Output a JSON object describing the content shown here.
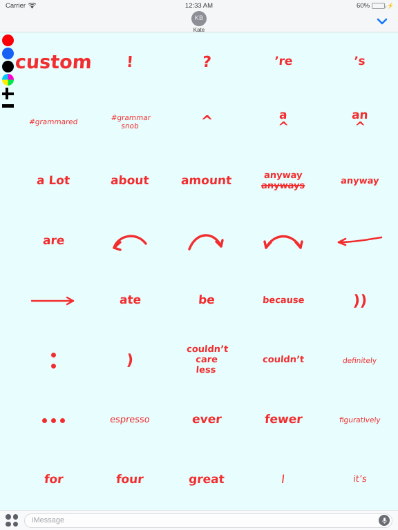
{
  "status_bar": {
    "carrier": "Carrier",
    "wifi_icon": "wifi-icon",
    "time": "12:33 AM",
    "battery_percent": "60%",
    "battery_level": 60,
    "battery_color": "#4cd964",
    "charging_icon": "lightning-bolt-icon"
  },
  "conversation_header": {
    "avatar_initials": "KB",
    "contact_name": "Kate",
    "expand_icon": "chevron-down-icon",
    "accent_color": "#1577ff"
  },
  "tool_rail": {
    "swatches": [
      {
        "name": "color-swatch-red",
        "label": "Red",
        "color": "#fb0007"
      },
      {
        "name": "color-swatch-blue",
        "label": "Blue",
        "color": "#1660f4"
      },
      {
        "name": "color-swatch-black",
        "label": "Black",
        "color": "#000000"
      },
      {
        "name": "color-wheel",
        "label": "Color wheel",
        "color": "multicolor"
      }
    ],
    "zoom_in_icon": "plus-icon",
    "zoom_out_icon": "minus-icon"
  },
  "canvas": {
    "background_color": "#e8fdfd",
    "ink_color": "#f22d2f",
    "rows": 8,
    "columns": 5
  },
  "stickers": [
    {
      "id": "custom",
      "text": "custom",
      "kind": "text",
      "size": "xl"
    },
    {
      "id": "exclamation",
      "text": "!",
      "kind": "text",
      "size": "lg"
    },
    {
      "id": "question",
      "text": "?",
      "kind": "text",
      "size": "lg"
    },
    {
      "id": "apostrophe-re",
      "text": "’re",
      "kind": "text",
      "size": "md"
    },
    {
      "id": "apostrophe-s",
      "text": "’s",
      "kind": "text",
      "size": "md"
    },
    {
      "id": "hashtag-grammared",
      "text": "#grammared",
      "kind": "text",
      "size": "xs"
    },
    {
      "id": "hashtag-grammar-snob",
      "text": "#grammar\nsnob",
      "kind": "text",
      "size": "xs"
    },
    {
      "id": "caret",
      "text": "^",
      "kind": "text",
      "size": "lg"
    },
    {
      "id": "a-caret",
      "text": "a",
      "sub": "^",
      "kind": "stack",
      "size": "md"
    },
    {
      "id": "an-caret",
      "text": "an",
      "sub": "^",
      "kind": "stack",
      "size": "md"
    },
    {
      "id": "a-lot",
      "text": "a  Lot",
      "kind": "text",
      "size": "md"
    },
    {
      "id": "about",
      "text": "about",
      "kind": "text",
      "size": "md"
    },
    {
      "id": "amount",
      "text": "amount",
      "kind": "text",
      "size": "md"
    },
    {
      "id": "anyway-not-anyways",
      "text": "anyway",
      "strike": "anyways",
      "kind": "correction",
      "size": "sm"
    },
    {
      "id": "anyway",
      "text": "anyway",
      "kind": "text",
      "size": "sm"
    },
    {
      "id": "are",
      "text": "are",
      "kind": "text",
      "size": "md"
    },
    {
      "id": "curved-arrow-left",
      "text": "",
      "kind": "icon",
      "icon": "curved-arrow-left-icon"
    },
    {
      "id": "curved-arrow-right",
      "text": "",
      "kind": "icon",
      "icon": "curved-arrow-right-icon"
    },
    {
      "id": "double-curved-arrow",
      "text": "",
      "kind": "icon",
      "icon": "double-headed-curved-arrow-icon"
    },
    {
      "id": "arrow-left",
      "text": "",
      "kind": "icon",
      "icon": "arrow-left-icon"
    },
    {
      "id": "arrow-right",
      "text": "",
      "kind": "icon",
      "icon": "arrow-right-icon"
    },
    {
      "id": "ate",
      "text": "ate",
      "kind": "text",
      "size": "md"
    },
    {
      "id": "be",
      "text": "be",
      "kind": "text",
      "size": "md"
    },
    {
      "id": "because",
      "text": "because",
      "kind": "text",
      "size": "sm"
    },
    {
      "id": "close-parens",
      "text": "))",
      "kind": "text",
      "size": "lg"
    },
    {
      "id": "colon",
      "text": "",
      "kind": "icon",
      "icon": "colon-dots-icon"
    },
    {
      "id": "right-parenthesis",
      "text": ")",
      "kind": "text",
      "size": "lg"
    },
    {
      "id": "couldnt-care-less",
      "text": "couldn’t\ncare\nless",
      "kind": "text",
      "size": "sm"
    },
    {
      "id": "couldnt",
      "text": "couldn’t",
      "kind": "text",
      "size": "sm"
    },
    {
      "id": "definitely",
      "text": "definitely",
      "kind": "text",
      "size": "xs"
    },
    {
      "id": "ellipsis",
      "text": "",
      "kind": "icon",
      "icon": "ellipsis-dots-icon"
    },
    {
      "id": "espresso",
      "text": "espresso",
      "kind": "text",
      "size": "sm"
    },
    {
      "id": "ever",
      "text": "ever",
      "kind": "text",
      "size": "md"
    },
    {
      "id": "fewer",
      "text": "fewer",
      "kind": "text",
      "size": "md"
    },
    {
      "id": "figuratively",
      "text": "figuratively",
      "kind": "text",
      "size": "xs"
    },
    {
      "id": "for",
      "text": "for",
      "kind": "text",
      "size": "md"
    },
    {
      "id": "four",
      "text": "four",
      "kind": "text",
      "size": "md"
    },
    {
      "id": "great",
      "text": "great",
      "kind": "text",
      "size": "md"
    },
    {
      "id": "capital-i",
      "text": "I",
      "kind": "text",
      "size": "md"
    },
    {
      "id": "its",
      "text": "it’s",
      "kind": "text",
      "size": "sm"
    }
  ],
  "bottom_bar": {
    "apps_icon": "app-grid-icon",
    "message_value": "",
    "message_placeholder": "iMessage",
    "record_icon": "microphone-icon"
  }
}
